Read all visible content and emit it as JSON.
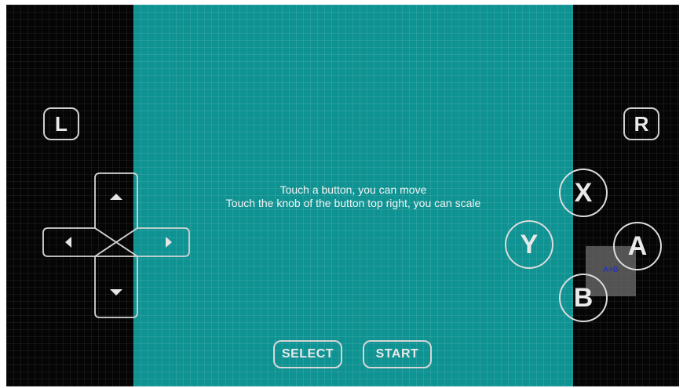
{
  "instructions": {
    "line1": "Touch a button, you can move",
    "line2": "Touch the knob of the button top right, you can scale"
  },
  "shoulder_buttons": {
    "left_label": "L",
    "right_label": "R"
  },
  "face_buttons": {
    "x_label": "X",
    "y_label": "Y",
    "a_label": "A",
    "b_label": "B"
  },
  "combo_button": {
    "label": "A+B"
  },
  "system_buttons": {
    "select_label": "SELECT",
    "start_label": "START"
  },
  "dpad": {
    "up_icon": "arrow-up-icon",
    "down_icon": "arrow-down-icon",
    "left_icon": "arrow-left-icon",
    "right_icon": "arrow-right-icon"
  },
  "colors": {
    "play_area": "#0f9292",
    "background": "#050505",
    "outline": "#dcdcdc",
    "combo_text": "#1f2bd6"
  }
}
